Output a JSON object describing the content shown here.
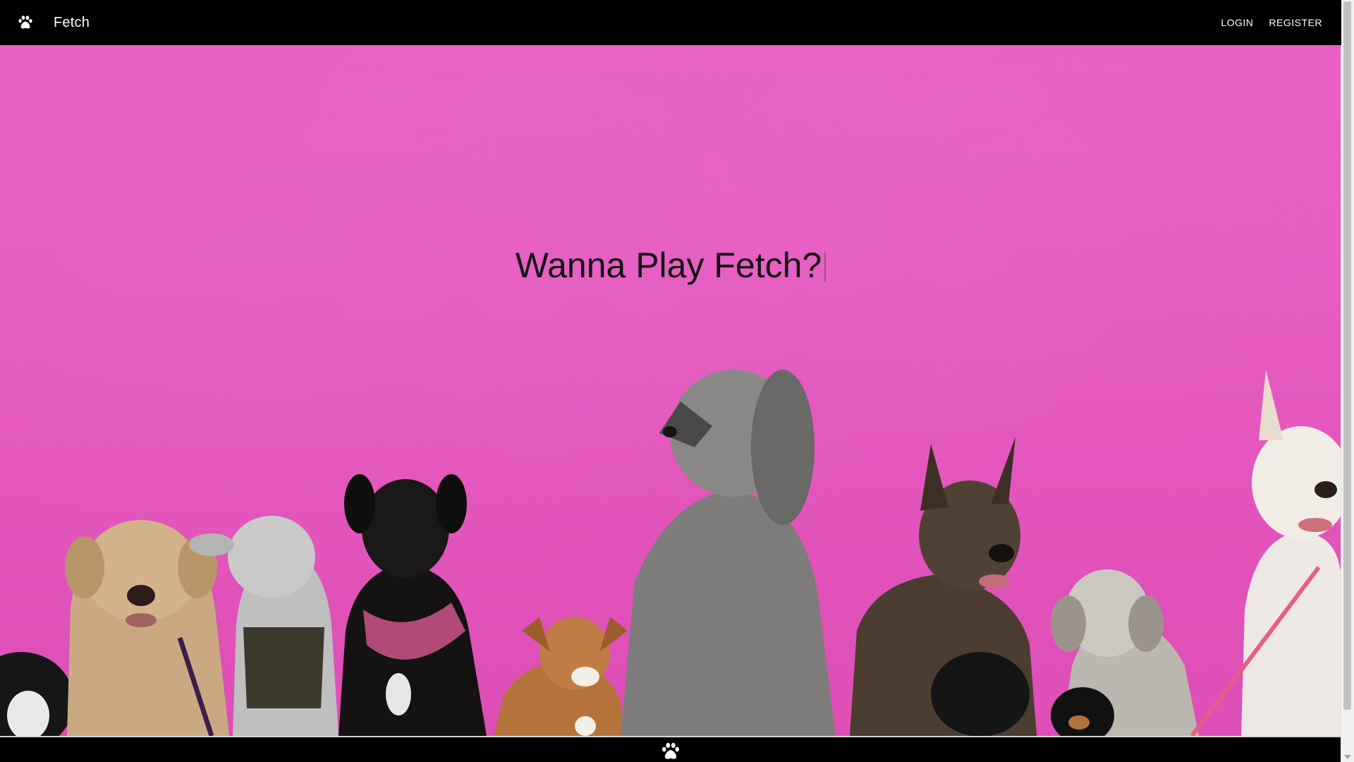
{
  "app_bar": {
    "brand_icon": "paw-icon",
    "title": "Fetch",
    "nav": {
      "login_label": "LOGIN",
      "register_label": "REGISTER"
    }
  },
  "hero": {
    "title": "Wanna Play Fetch?",
    "background_color": "#e455bd",
    "image": "group-of-dogs-against-pink-wall"
  },
  "footer": {
    "icon": "paw-icon"
  },
  "colors": {
    "bar": "#000000",
    "text_on_bar": "#ffffff",
    "hero_title": "#111111"
  }
}
